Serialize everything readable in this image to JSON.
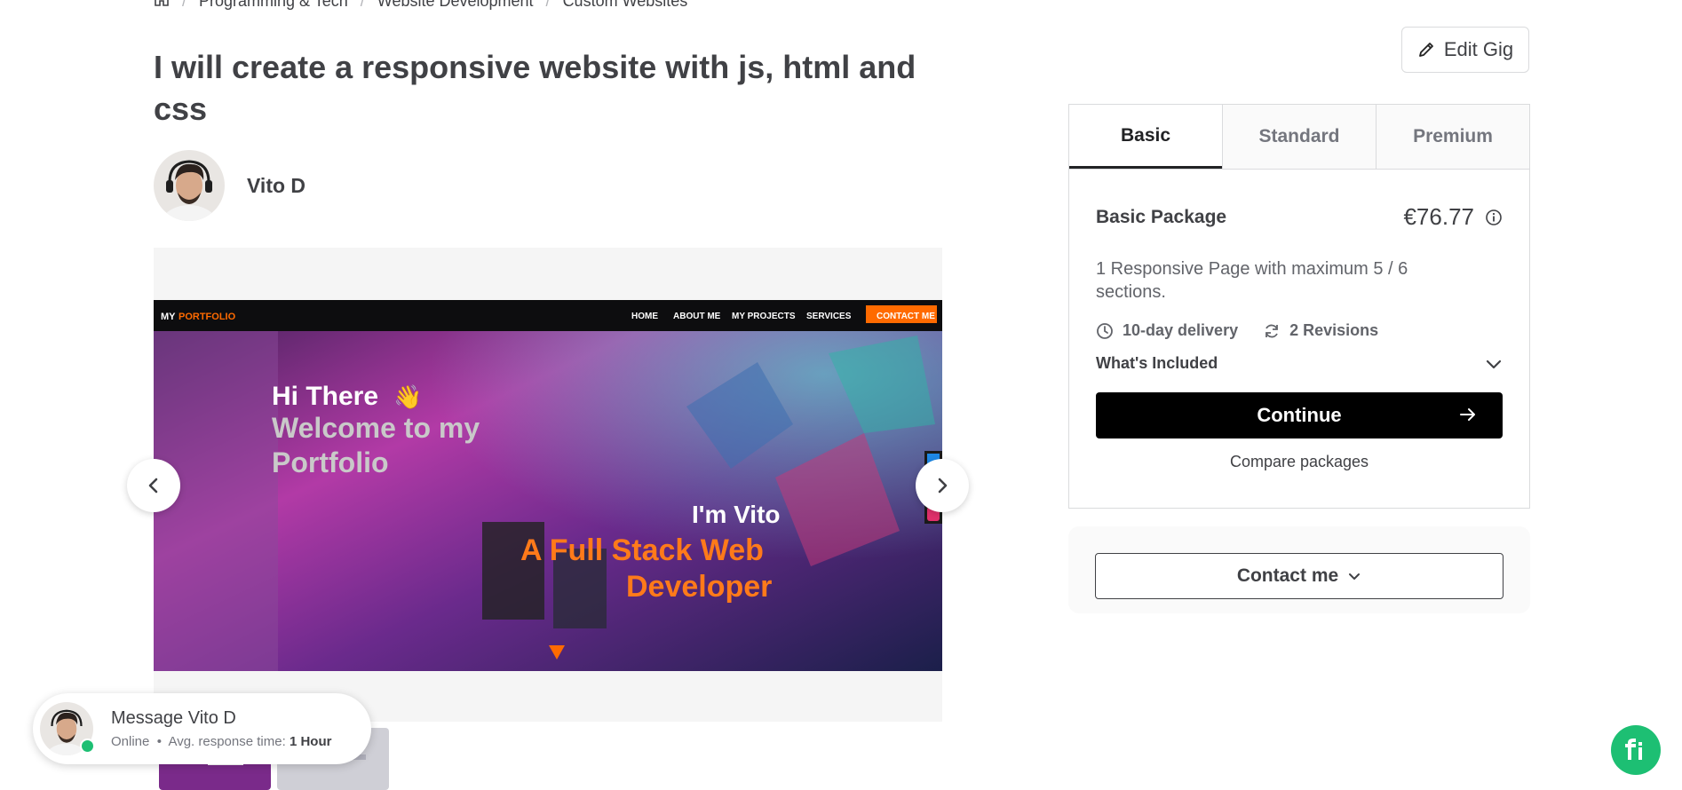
{
  "breadcrumb": {
    "home_icon": "home-icon",
    "items": [
      "Programming & Tech",
      "Website Development",
      "Custom Websites"
    ]
  },
  "gig": {
    "title": "I will create a responsive website with js, html and css",
    "seller_name": "Vito D"
  },
  "slide": {
    "nav_logo_a": "MY",
    "nav_logo_b": "PORTFOLIO",
    "nav_links": [
      "HOME",
      "ABOUT ME",
      "MY PROJECTS",
      "SERVICES"
    ],
    "nav_cta": "CONTACT ME",
    "hi": "Hi There",
    "welcome_1": "Welcome to my",
    "welcome_2": "Portfolio",
    "im": "I'm Vito",
    "role_1": "A Full Stack Web",
    "role_2": "Developer"
  },
  "edit_gig": {
    "label": "Edit Gig",
    "icon": "pencil-icon"
  },
  "package": {
    "tabs": [
      {
        "label": "Basic",
        "active": true
      },
      {
        "label": "Standard",
        "active": false
      },
      {
        "label": "Premium",
        "active": false
      }
    ],
    "name": "Basic Package",
    "price": "€76.77",
    "description": "1 Responsive Page with maximum 5 / 6 sections.",
    "delivery": "10-day delivery",
    "revisions": "2 Revisions",
    "included": "What's Included",
    "continue": "Continue",
    "compare": "Compare packages"
  },
  "contact": {
    "label": "Contact me"
  },
  "message": {
    "title": "Message Vito D",
    "status": "Online",
    "response_label": "Avg. response time:",
    "response_value": "1 Hour"
  },
  "colors": {
    "accent_green": "#1dbf73",
    "cta_orange": "#ff6a00",
    "text": "#404145"
  }
}
